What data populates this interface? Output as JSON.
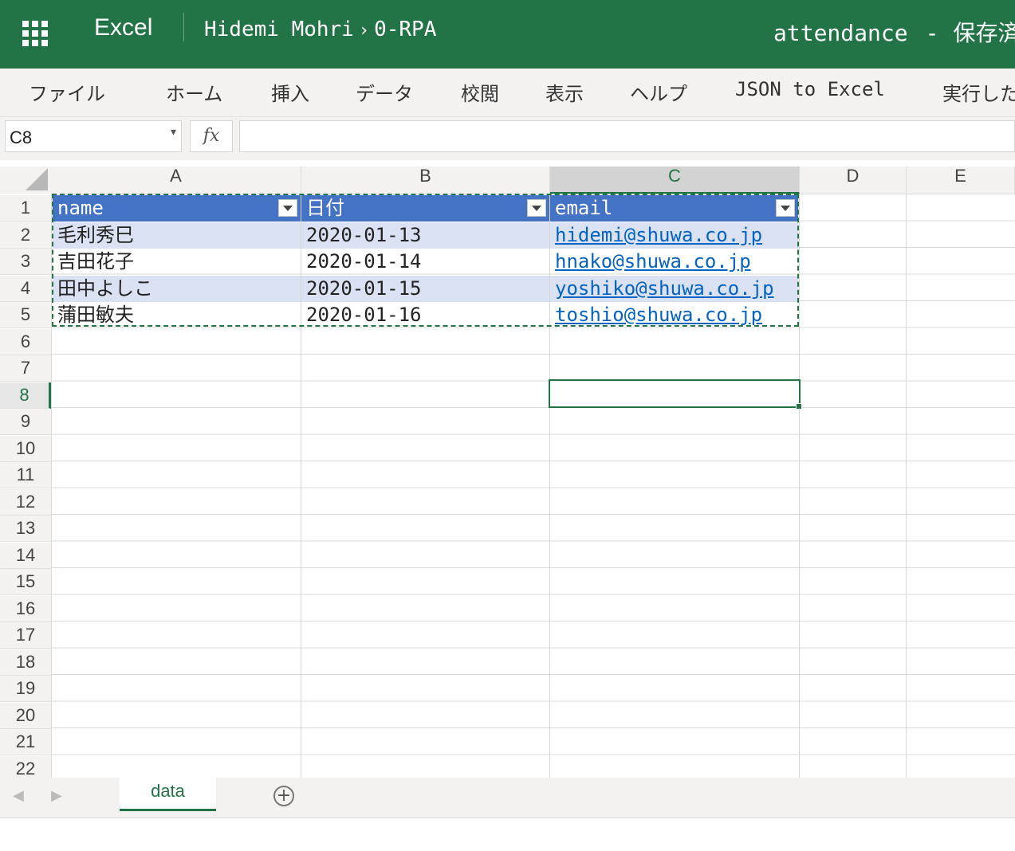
{
  "titlebar": {
    "app_name": "Excel",
    "breadcrumb_user": "Hidemi Mohri",
    "breadcrumb_folder": "0-RPA",
    "document_name": "attendance",
    "separator": "-",
    "save_status": "保存済"
  },
  "ribbon": {
    "tabs": [
      "ファイル",
      "ホーム",
      "挿入",
      "データ",
      "校閲",
      "表示",
      "ヘルプ",
      "JSON to Excel",
      "実行した"
    ]
  },
  "formula_bar": {
    "name_box": "C8",
    "fx_label": "fx",
    "formula": ""
  },
  "columns": [
    "A",
    "B",
    "C",
    "D",
    "E"
  ],
  "rows": [
    "1",
    "2",
    "3",
    "4",
    "5",
    "6",
    "7",
    "8",
    "9",
    "10",
    "11",
    "12",
    "13",
    "14",
    "15",
    "16",
    "17",
    "18",
    "19",
    "20",
    "21",
    "22"
  ],
  "table": {
    "headers": [
      "name",
      "日付",
      "email"
    ],
    "rows": [
      [
        "毛利秀巳",
        "2020-01-13",
        "hidemi@shuwa.co.jp"
      ],
      [
        "吉田花子",
        "2020-01-14",
        "hnako@shuwa.co.jp"
      ],
      [
        "田中よしこ",
        "2020-01-15",
        "yoshiko@shuwa.co.jp"
      ],
      [
        "蒲田敏夫",
        "2020-01-16",
        "toshio@shuwa.co.jp"
      ]
    ]
  },
  "sheets": {
    "active": "data",
    "add_label": "+"
  },
  "colors": {
    "brand_green": "#227446",
    "table_header": "#4472c4",
    "table_band": "#d9e1f2",
    "link": "#0563c1"
  }
}
